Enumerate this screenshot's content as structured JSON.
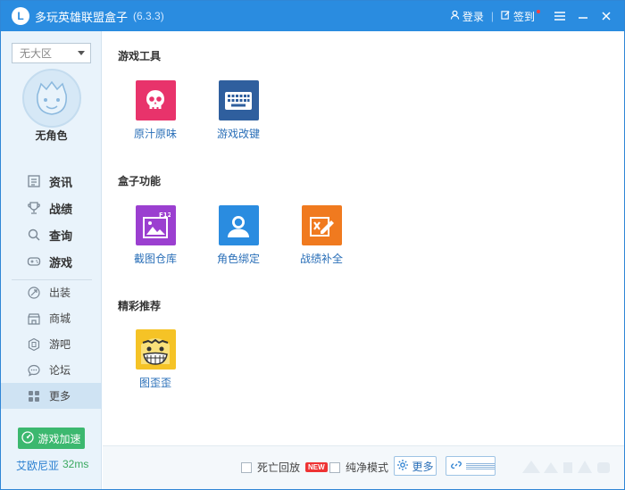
{
  "titlebar": {
    "title": "多玩英雄联盟盒子",
    "version": "(6.3.3)",
    "login_label": "登录",
    "checkin_label": "签到",
    "separator": "|"
  },
  "sidebar": {
    "region_selected": "无大区",
    "role_name": "无角色",
    "main_nav": [
      {
        "label": "资讯",
        "icon": "news-icon"
      },
      {
        "label": "战绩",
        "icon": "trophy-icon"
      },
      {
        "label": "查询",
        "icon": "search-icon"
      },
      {
        "label": "游戏",
        "icon": "gamepad-icon"
      }
    ],
    "sub_nav": [
      {
        "label": "出装",
        "icon": "equipment-icon"
      },
      {
        "label": "商城",
        "icon": "shop-icon"
      },
      {
        "label": "游吧",
        "icon": "forum-badge-icon"
      },
      {
        "label": "论坛",
        "icon": "chat-icon"
      },
      {
        "label": "更多",
        "icon": "grid-icon",
        "active": true
      }
    ],
    "accel_label": "游戏加速",
    "server_name": "艾欧尼亚",
    "ping": "32ms"
  },
  "main": {
    "sections": [
      {
        "title": "游戏工具",
        "tools": [
          {
            "label": "原汁原味",
            "icon": "skull-icon",
            "color": "#e8336b"
          },
          {
            "label": "游戏改键",
            "icon": "keyboard-icon",
            "color": "#2f5f9e"
          }
        ]
      },
      {
        "title": "盒子功能",
        "tools": [
          {
            "label": "截图仓库",
            "icon": "screenshot-icon",
            "color": "#9b3fd0",
            "badge": "F12"
          },
          {
            "label": "角色绑定",
            "icon": "user-icon",
            "color": "#2a8ce0"
          },
          {
            "label": "战绩补全",
            "icon": "edit-icon",
            "color": "#f07a1f"
          }
        ]
      },
      {
        "title": "精彩推荐",
        "tools": [
          {
            "label": "图歪歪",
            "icon": "cartoon-face-icon",
            "color": "#f5c326"
          }
        ]
      }
    ]
  },
  "bottombar": {
    "death_replay_label": "死亡回放",
    "new_badge": "NEW",
    "pure_mode_label": "纯净模式",
    "more_label": "更多"
  },
  "colors": {
    "brand": "#2a8ce0",
    "sidebar_bg": "#e9f3fb",
    "accel_green": "#3cb86f",
    "link_blue": "#2a6fb8"
  }
}
